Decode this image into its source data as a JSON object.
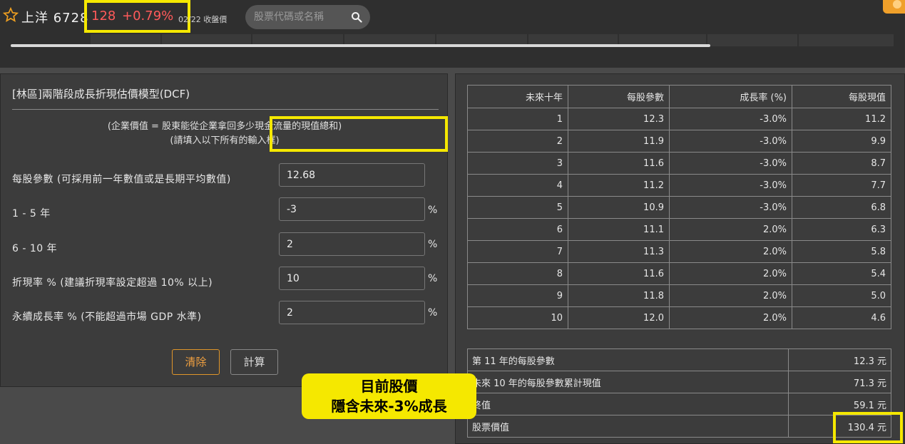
{
  "header": {
    "stock_name": "上洋 6728",
    "price": "128",
    "change": "+0.79%",
    "date_label": "02/22 收盤價",
    "search_placeholder": "股票代碼或名稱"
  },
  "form": {
    "title": "[林區]兩階段成長折現估價模型(DCF)",
    "desc_line1": "(企業價值 = 股東能從企業拿回多少現金流量的現值總和)",
    "desc_line2": "(請填入以下所有的輸入框)",
    "fields": [
      {
        "label": "每股參數 (可採用前一年數值或是長期平均數值)",
        "value": "12.68",
        "unit": ""
      },
      {
        "label": "1 - 5 年",
        "value": "-3",
        "unit": "%"
      },
      {
        "label": "6 - 10 年",
        "value": "2",
        "unit": "%"
      },
      {
        "label": "折現率 % (建議折現率設定超過 10% 以上)",
        "value": "10",
        "unit": "%"
      },
      {
        "label": "永續成長率 % (不能超過市場 GDP 水準)",
        "value": "2",
        "unit": "%"
      }
    ],
    "clear_label": "清除",
    "calc_label": "計算"
  },
  "projection": {
    "headers": [
      "未來十年",
      "每股參數",
      "成長率 (%)",
      "每股現值"
    ],
    "rows": [
      [
        "1",
        "12.3",
        "-3.0%",
        "11.2"
      ],
      [
        "2",
        "11.9",
        "-3.0%",
        "9.9"
      ],
      [
        "3",
        "11.6",
        "-3.0%",
        "8.7"
      ],
      [
        "4",
        "11.2",
        "-3.0%",
        "7.7"
      ],
      [
        "5",
        "10.9",
        "-3.0%",
        "6.8"
      ],
      [
        "6",
        "11.1",
        "2.0%",
        "6.3"
      ],
      [
        "7",
        "11.3",
        "2.0%",
        "5.8"
      ],
      [
        "8",
        "11.6",
        "2.0%",
        "5.4"
      ],
      [
        "9",
        "11.8",
        "2.0%",
        "5.0"
      ],
      [
        "10",
        "12.0",
        "2.0%",
        "4.6"
      ]
    ]
  },
  "summary": [
    {
      "label": "第 11 年的每股參數",
      "value": "12.3 元"
    },
    {
      "label": "未來 10 年的每股參數累計現值",
      "value": "71.3 元"
    },
    {
      "label": "終值",
      "value": "59.1 元"
    },
    {
      "label": "股票價值",
      "value": "130.4 元"
    }
  ],
  "callout": {
    "line1": "目前股價",
    "line2": "隱含未來-3%成長"
  },
  "colors": {
    "highlight": "#f5e800",
    "price_red": "#ff5a5a",
    "accent_orange": "#f0a040"
  }
}
